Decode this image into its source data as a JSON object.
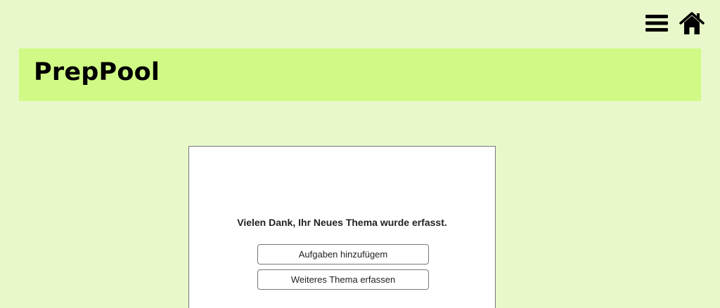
{
  "app": {
    "title": "PrepPool"
  },
  "header": {
    "icons": [
      "hamburger-menu-icon",
      "home-icon"
    ]
  },
  "confirmation": {
    "message": "Vielen Dank, Ihr Neues Thema wurde erfasst.",
    "buttons": [
      {
        "label": "Aufgaben hinzufügem"
      },
      {
        "label": "Weiteres Thema erfassen"
      }
    ]
  },
  "colors": {
    "background": "#e8f8cb",
    "banner": "#d0fa85",
    "card": "#ffffff",
    "icon": "#000000"
  }
}
